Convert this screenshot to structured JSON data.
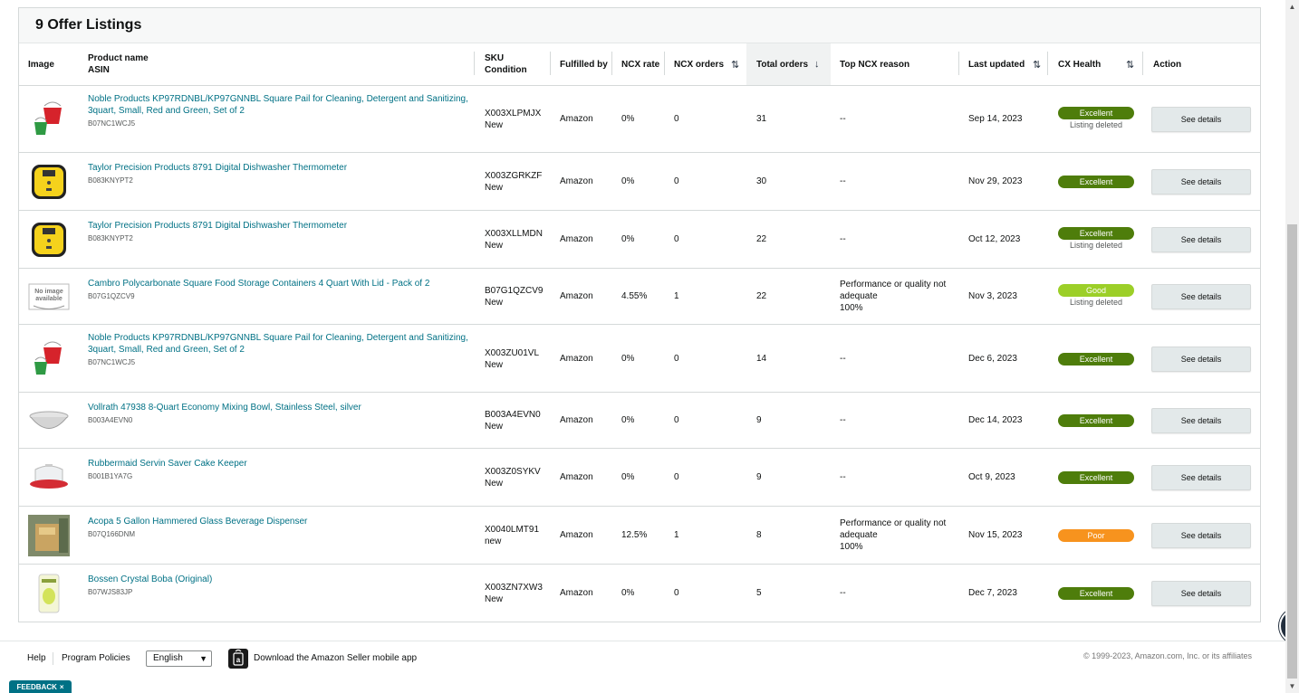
{
  "card": {
    "title": "9 Offer Listings"
  },
  "columns": {
    "image": "Image",
    "product_name": "Product name",
    "asin": "ASIN",
    "sku": "SKU",
    "condition": "Condition",
    "fulfilled_by": "Fulfilled by",
    "ncx_rate": "NCX rate",
    "ncx_orders": "NCX orders",
    "total_orders": "Total orders",
    "top_ncx_reason": "Top NCX reason",
    "last_updated": "Last updated",
    "cx_health": "CX Health",
    "action": "Action"
  },
  "rows": [
    {
      "image_icon": "red-green-pail-icon",
      "name": "Noble Products KP97RDNBL/KP97GNNBL Square Pail for Cleaning, Detergent and Sanitizing, 3quart, Small, Red and Green, Set of 2",
      "asin": "B07NC1WCJ5",
      "sku": "X003XLPMJX",
      "condition": "New",
      "fulfilled_by": "Amazon",
      "ncx_rate": "0%",
      "ncx_orders": "0",
      "total_orders": "31",
      "reason": "--",
      "reason_pct": "",
      "last_updated": "Sep 14, 2023",
      "health": "Excellent",
      "health_note": "Listing deleted",
      "action": "See details"
    },
    {
      "image_icon": "yellow-thermometer-icon",
      "name": "Taylor Precision Products 8791 Digital Dishwasher Thermometer",
      "asin": "B083KNYPT2",
      "sku": "X003ZGRKZF",
      "condition": "New",
      "fulfilled_by": "Amazon",
      "ncx_rate": "0%",
      "ncx_orders": "0",
      "total_orders": "30",
      "reason": "--",
      "reason_pct": "",
      "last_updated": "Nov 29, 2023",
      "health": "Excellent",
      "health_note": "",
      "action": "See details"
    },
    {
      "image_icon": "yellow-thermometer-icon",
      "name": "Taylor Precision Products 8791 Digital Dishwasher Thermometer",
      "asin": "B083KNYPT2",
      "sku": "X003XLLMDN",
      "condition": "New",
      "fulfilled_by": "Amazon",
      "ncx_rate": "0%",
      "ncx_orders": "0",
      "total_orders": "22",
      "reason": "--",
      "reason_pct": "",
      "last_updated": "Oct 12, 2023",
      "health": "Excellent",
      "health_note": "Listing deleted",
      "action": "See details"
    },
    {
      "image_icon": "no-image-available-icon",
      "no_image_text": "No image available",
      "name": "Cambro Polycarbonate Square Food Storage Containers 4 Quart With Lid - Pack of 2",
      "asin": "B07G1QZCV9",
      "sku": "B07G1QZCV9",
      "condition": "New",
      "fulfilled_by": "Amazon",
      "ncx_rate": "4.55%",
      "ncx_orders": "1",
      "total_orders": "22",
      "reason": "Performance or quality not adequate",
      "reason_pct": "100%",
      "last_updated": "Nov 3, 2023",
      "health": "Good",
      "health_note": "Listing deleted",
      "action": "See details"
    },
    {
      "image_icon": "red-green-pail-icon",
      "name": "Noble Products KP97RDNBL/KP97GNNBL Square Pail for Cleaning, Detergent and Sanitizing, 3quart, Small, Red and Green, Set of 2",
      "asin": "B07NC1WCJ5",
      "sku": "X003ZU01VL",
      "condition": "New",
      "fulfilled_by": "Amazon",
      "ncx_rate": "0%",
      "ncx_orders": "0",
      "total_orders": "14",
      "reason": "--",
      "reason_pct": "",
      "last_updated": "Dec 6, 2023",
      "health": "Excellent",
      "health_note": "",
      "action": "See details"
    },
    {
      "image_icon": "mixing-bowl-icon",
      "name": "Vollrath 47938 8-Quart Economy Mixing Bowl, Stainless Steel, silver",
      "asin": "B003A4EVN0",
      "sku": "B003A4EVN0",
      "condition": "New",
      "fulfilled_by": "Amazon",
      "ncx_rate": "0%",
      "ncx_orders": "0",
      "total_orders": "9",
      "reason": "--",
      "reason_pct": "",
      "last_updated": "Dec 14, 2023",
      "health": "Excellent",
      "health_note": "",
      "action": "See details"
    },
    {
      "image_icon": "cake-keeper-icon",
      "name": "Rubbermaid Servin Saver Cake Keeper",
      "asin": "B001B1YA7G",
      "sku": "X003Z0SYKV",
      "condition": "New",
      "fulfilled_by": "Amazon",
      "ncx_rate": "0%",
      "ncx_orders": "0",
      "total_orders": "9",
      "reason": "--",
      "reason_pct": "",
      "last_updated": "Oct 9, 2023",
      "health": "Excellent",
      "health_note": "",
      "action": "See details"
    },
    {
      "image_icon": "beverage-dispenser-icon",
      "name": "Acopa 5 Gallon Hammered Glass Beverage Dispenser",
      "asin": "B07Q166DNM",
      "sku": "X0040LMT91",
      "condition": "new",
      "fulfilled_by": "Amazon",
      "ncx_rate": "12.5%",
      "ncx_orders": "1",
      "total_orders": "8",
      "reason": "Performance or quality not adequate",
      "reason_pct": "100%",
      "last_updated": "Nov 15, 2023",
      "health": "Poor",
      "health_note": "",
      "action": "See details"
    },
    {
      "image_icon": "boba-package-icon",
      "name": "Bossen Crystal Boba (Original)",
      "asin": "B07WJS83JP",
      "sku": "X003ZN7XW3",
      "condition": "New",
      "fulfilled_by": "Amazon",
      "ncx_rate": "0%",
      "ncx_orders": "0",
      "total_orders": "5",
      "reason": "--",
      "reason_pct": "",
      "last_updated": "Dec 7, 2023",
      "health": "Excellent",
      "health_note": "",
      "action": "See details"
    }
  ],
  "footer": {
    "help": "Help",
    "program_policies": "Program Policies",
    "language": "English",
    "app_link": "Download the Amazon Seller mobile app",
    "copyright": "© 1999-2023, Amazon.com, Inc. or its affiliates"
  },
  "feedback": {
    "label": "FEEDBACK",
    "close": "×"
  },
  "colors": {
    "link": "#007185",
    "excellent": "#4e7d0b",
    "good": "#9ccf28",
    "poor": "#f7931e",
    "button": "#e3e9ea"
  }
}
